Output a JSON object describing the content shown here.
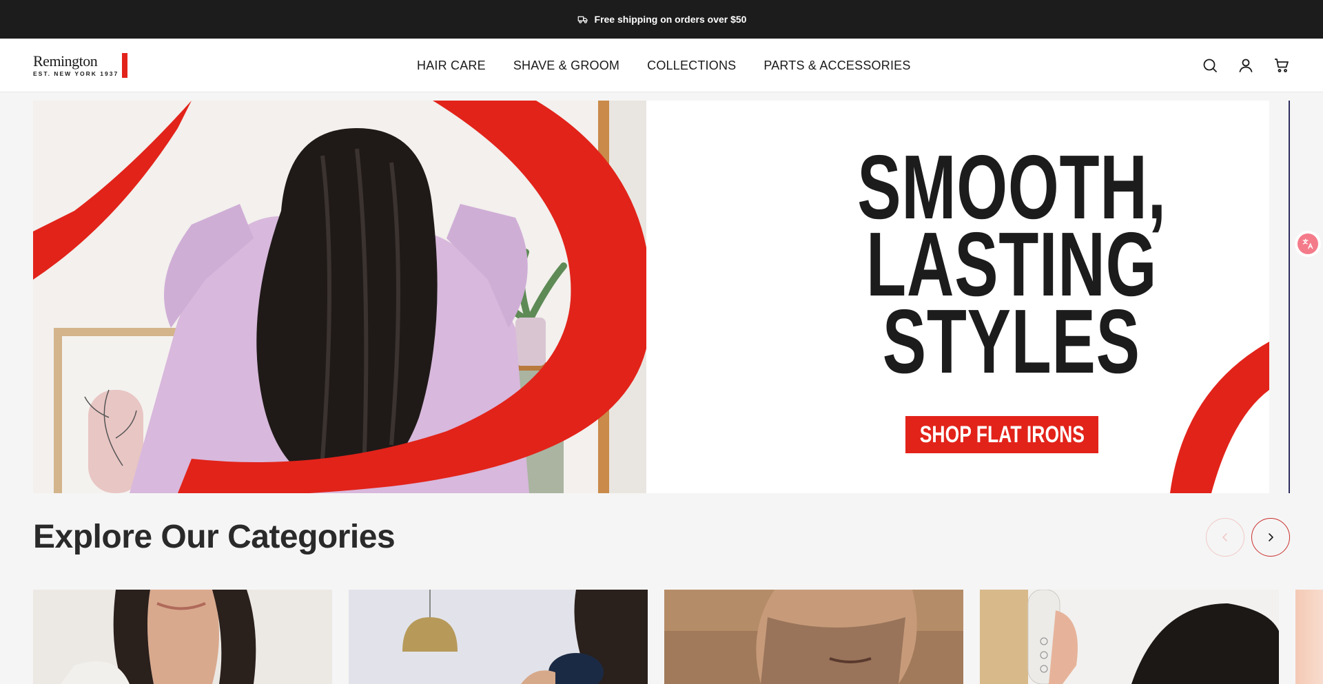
{
  "announcement": {
    "icon": "truck-icon",
    "text": "Free shipping on orders over $50"
  },
  "header": {
    "logo": {
      "name": "Remington",
      "tagline": "EST. NEW YORK 1937"
    },
    "nav": [
      {
        "label": "HAIR CARE"
      },
      {
        "label": "SHAVE & GROOM"
      },
      {
        "label": "COLLECTIONS"
      },
      {
        "label": "PARTS & ACCESSORIES"
      }
    ],
    "icons": [
      "search-icon",
      "account-icon",
      "cart-icon"
    ]
  },
  "hero": {
    "headline": [
      "SMOOTH,",
      "LASTING",
      "STYLES"
    ],
    "cta_label": "SHOP FLAT IRONS"
  },
  "categories": {
    "title": "Explore Our Categories",
    "prev_icon": "chevron-left-icon",
    "next_icon": "chevron-right-icon"
  },
  "colors": {
    "brand_red": "#e2231a",
    "announcement_bg": "#1c1c1c",
    "page_bg": "#f5f5f5"
  }
}
